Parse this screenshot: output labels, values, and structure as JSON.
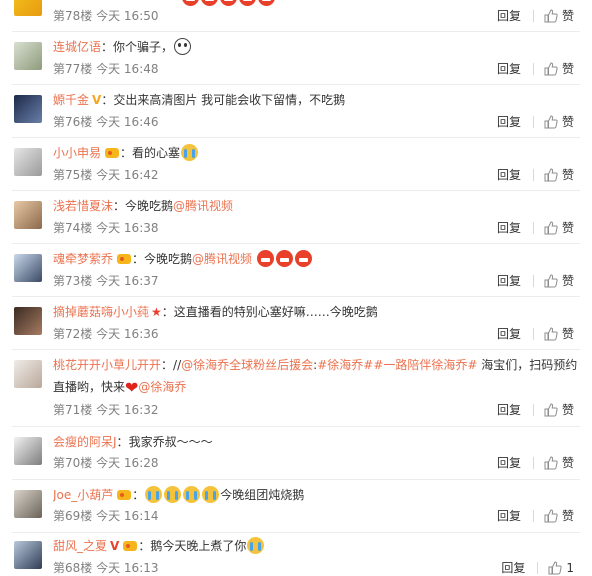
{
  "colors": {
    "username": "#eb7350",
    "meta": "#808080",
    "divider": "#ececec"
  },
  "actions": {
    "reply_label": "回复",
    "like_label": "赞"
  },
  "comments": [
    {
      "user": "",
      "text": "",
      "floor": "第78楼",
      "time": "今天 16:50",
      "likes": ""
    },
    {
      "user": "连城亿语",
      "text": "你个骗子，",
      "floor": "第77楼",
      "time": "今天 16:48",
      "likes": ""
    },
    {
      "user": "嫄千金",
      "text": "交出来高清图片  我可能会收下留情，不吃鹅",
      "floor": "第76楼",
      "time": "今天 16:46",
      "likes": ""
    },
    {
      "user": "小小申易",
      "text": "看的心塞",
      "floor": "第75楼",
      "time": "今天 16:42",
      "likes": ""
    },
    {
      "user": "浅若惜夏沫",
      "text": "今晚吃鹅",
      "link": "@腾讯视频",
      "floor": "第74楼",
      "time": "今天 16:38",
      "likes": ""
    },
    {
      "user": "魂牵梦萦乔",
      "text": "今晚吃鹅",
      "link": "@腾讯视频",
      "floor": "第73楼",
      "time": "今天 16:37",
      "likes": ""
    },
    {
      "user": "摘掉蘑菇嗨小小莼",
      "text": "这直播看的特别心塞好嘛……今晚吃鹅",
      "floor": "第72楼",
      "time": "今天 16:36",
      "likes": ""
    },
    {
      "user": "桃花开开小草儿开开",
      "text_a": "//",
      "link_a": "@徐海乔全球粉丝后援会",
      "text_b": ":",
      "link_b": "#徐海乔#",
      "link_c": "#一路陪伴徐海乔#",
      "text_c": " 海宝们，扫码预约",
      "line2_text": "直播哟，快来",
      "line2_link": "@徐海乔",
      "floor": "第71楼",
      "time": "今天 16:32",
      "likes": ""
    },
    {
      "user": "会瘦的阿呆J",
      "text": "我家乔叔～～～",
      "floor": "第70楼",
      "time": "今天 16:28",
      "likes": ""
    },
    {
      "user": "Joe_小葫芦",
      "text": "今晚组团炖烧鹅",
      "floor": "第69楼",
      "time": "今天 16:14",
      "likes": ""
    },
    {
      "user": "甜风_之夏",
      "text": "鹅今天晚上煮了你",
      "floor": "第68楼",
      "time": "今天 16:13",
      "likes": "1"
    }
  ]
}
